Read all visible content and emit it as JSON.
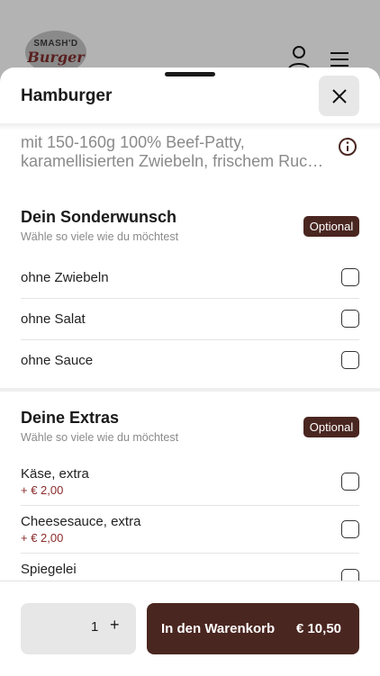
{
  "header": {
    "logo_top": "SMASH'D",
    "logo_bottom": "Burger"
  },
  "sheet": {
    "title": "Hamburger",
    "description_lines": [
      "mit 150-160g 100% Beef-Patty,",
      "karamellisierten Zwiebeln, frischem Ruco..."
    ]
  },
  "groups": [
    {
      "title": "Dein Sonderwunsch",
      "subtitle": "Wähle so viele wie du möchtest",
      "badge": "Optional",
      "options": [
        {
          "label": "ohne Zwiebeln"
        },
        {
          "label": "ohne Salat"
        },
        {
          "label": "ohne Sauce"
        }
      ]
    },
    {
      "title": "Deine Extras",
      "subtitle": "Wähle so viele wie du möchtest",
      "badge": "Optional",
      "options": [
        {
          "label": "Käse, extra",
          "price": "+ € 2,00"
        },
        {
          "label": "Cheesesauce, extra",
          "price": "+ € 2,00"
        },
        {
          "label": "Spiegelei"
        }
      ]
    }
  ],
  "footer": {
    "quantity": "1",
    "plus": "+",
    "add_to_cart_label": "In den Warenkorb",
    "total_price": "€ 10,50"
  },
  "colors": {
    "brand": "#4a2620",
    "price": "#8b2a2a"
  }
}
